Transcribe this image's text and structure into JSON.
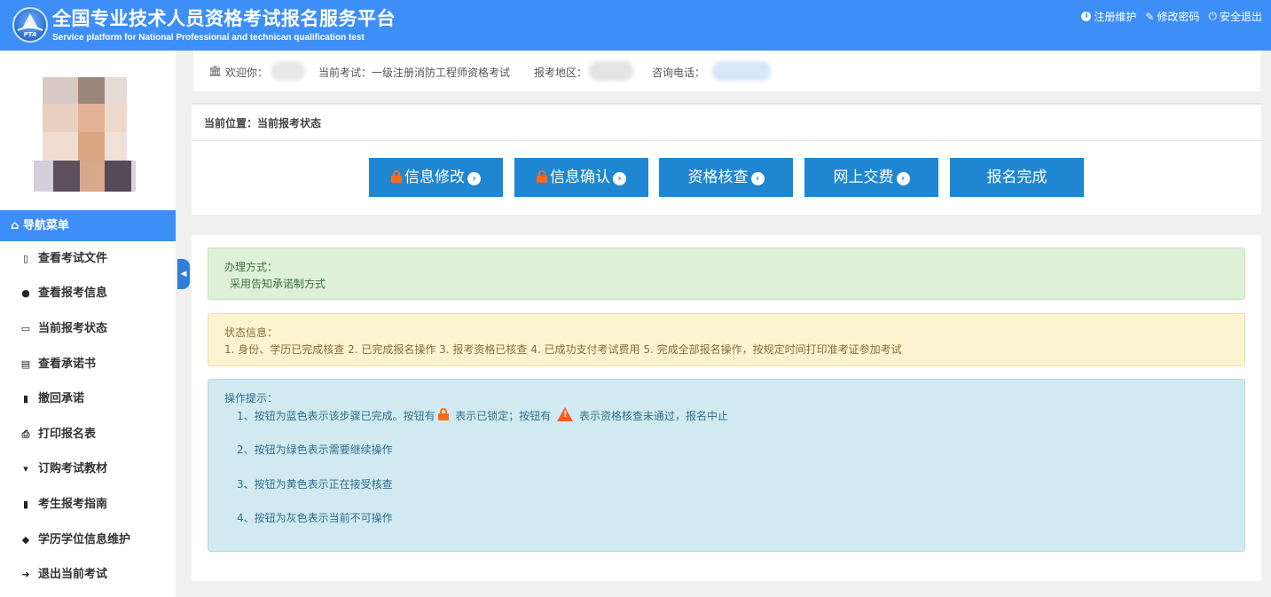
{
  "header": {
    "title_cn": "全国专业技术人员资格考试报名服务平台",
    "title_en": "Service platform for National Professional and technican qualification test",
    "logo_text": "PTA",
    "links": [
      {
        "label": "注册维护",
        "icon": "info-circle-icon"
      },
      {
        "label": "修改密码",
        "icon": "edit-icon"
      },
      {
        "label": "安全退出",
        "icon": "power-icon"
      }
    ]
  },
  "sidebar": {
    "nav_header": "导航菜单",
    "items": [
      {
        "label": "查看考试文件",
        "icon": "file-icon"
      },
      {
        "label": "查看报考信息",
        "icon": "info-circle-icon"
      },
      {
        "label": "当前报考状态",
        "icon": "monitor-icon"
      },
      {
        "label": "查看承诺书",
        "icon": "id-card-icon"
      },
      {
        "label": "撤回承诺",
        "icon": "book-icon"
      },
      {
        "label": "打印报名表",
        "icon": "print-icon"
      },
      {
        "label": "订购考试教材",
        "icon": "cart-icon"
      },
      {
        "label": "考生报考指南",
        "icon": "book-icon"
      },
      {
        "label": "学历学位信息维护",
        "icon": "graduation-cap-icon"
      },
      {
        "label": "退出当前考试",
        "icon": "sign-out-icon"
      }
    ]
  },
  "infobar": {
    "welcome_label": "欢迎你：",
    "exam_label": "当前考试：一级注册消防工程师资格考试",
    "region_label": "报考地区：",
    "phone_label": "咨询电话："
  },
  "steps": {
    "breadcrumb": "当前位置：当前报考状态",
    "buttons": [
      {
        "label": "信息修改",
        "locked": true
      },
      {
        "label": "信息确认",
        "locked": true
      },
      {
        "label": "资格核查",
        "locked": false
      },
      {
        "label": "网上交费",
        "locked": false
      },
      {
        "label": "报名完成",
        "locked": false
      }
    ],
    "color": "#1f87d1"
  },
  "alerts": {
    "method_title": "办理方式：",
    "method_text": "采用告知承诺制方式",
    "status_title": "状态信息：",
    "status_text": "1. 身份、学历已完成核查 2. 已完成报名操作 3. 报考资格已核查 4. 已成功支付考试费用 5. 完成全部报名操作，按规定时间打印准考证参加考试",
    "tips_title": "操作提示：",
    "tip1_a": "1、按钮为蓝色表示该步骤已完成。按钮有",
    "tip1_b": "表示已锁定；按钮有",
    "tip1_c": "表示资格核查未通过，报名中止",
    "tip2": "2、按钮为绿色表示需要继续操作",
    "tip3": "3、按钮为黄色表示正在接受核查",
    "tip4": "4、按钮为灰色表示当前不可操作"
  },
  "colors": {
    "header_bg": "#3d8ff7",
    "step_button": "#1f87d1",
    "lock": "#ff6a1a"
  }
}
